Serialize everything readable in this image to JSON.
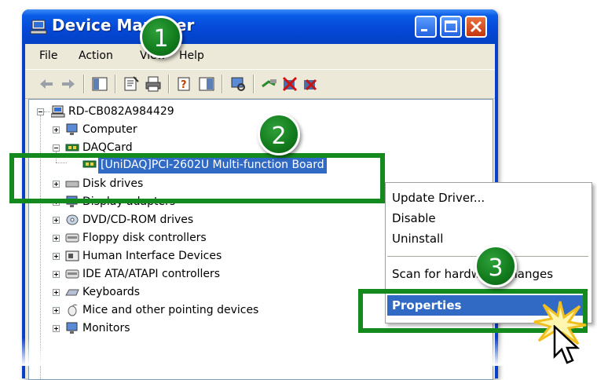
{
  "window": {
    "title": "Device Manager",
    "menu": [
      "File",
      "Action",
      "View",
      "Help"
    ]
  },
  "tree": {
    "root": "RD-CB082A984429",
    "items": [
      "Computer",
      "DAQCard",
      "[UniDAQ]PCI-2602U Multi-function Board",
      "Disk drives",
      "Display adapters",
      "DVD/CD-ROM drives",
      "Floppy disk controllers",
      "Human Interface Devices",
      "IDE ATA/ATAPI controllers",
      "Keyboards",
      "Mice and other pointing devices",
      "Monitors"
    ]
  },
  "context_menu": {
    "items": [
      "Update Driver...",
      "Disable",
      "Uninstall",
      "Scan for hardware changes",
      "Properties"
    ]
  },
  "badges": [
    "1",
    "2",
    "3"
  ],
  "colors": {
    "title_blue": "#0548d8",
    "selection_blue": "#316ac5",
    "highlight_green": "#148a1e"
  }
}
